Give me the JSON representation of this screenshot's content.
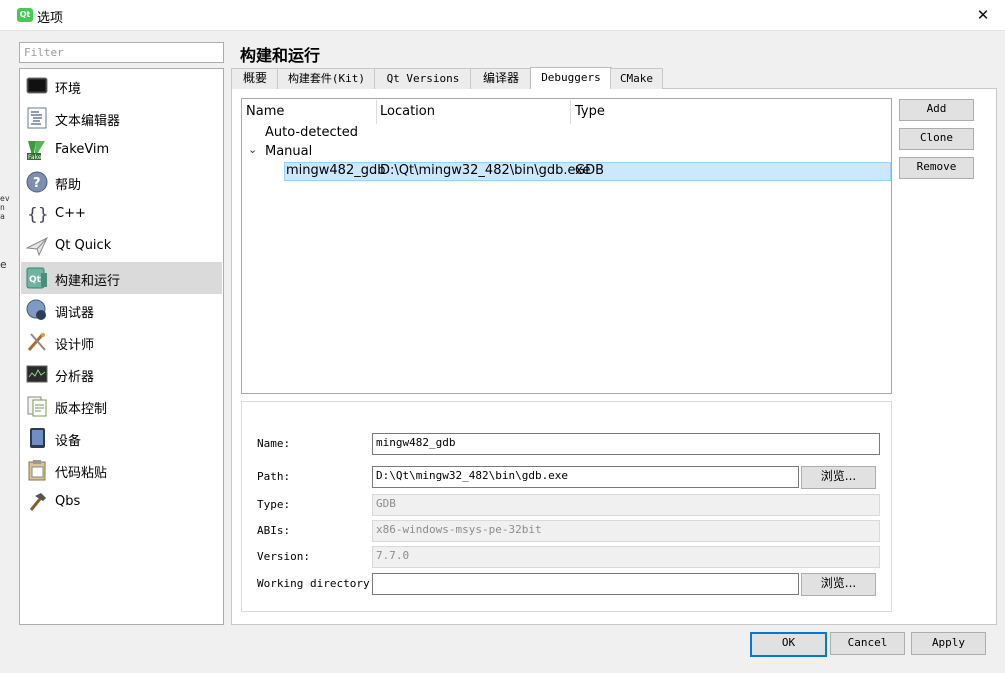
{
  "window": {
    "title": "选项",
    "app_icon": "qt-icon",
    "close": "✕"
  },
  "filter": {
    "placeholder": "Filter"
  },
  "categories": [
    {
      "label": "环境",
      "icon": "monitor-icon"
    },
    {
      "label": "文本编辑器",
      "icon": "text-editor-icon"
    },
    {
      "label": "FakeVim",
      "icon": "fakevim-icon"
    },
    {
      "label": "帮助",
      "icon": "help-icon"
    },
    {
      "label": "C++",
      "icon": "braces-icon"
    },
    {
      "label": "Qt Quick",
      "icon": "paper-plane-icon"
    },
    {
      "label": "构建和运行",
      "icon": "qt-build-icon",
      "selected": true
    },
    {
      "label": "调试器",
      "icon": "debugger-icon"
    },
    {
      "label": "设计师",
      "icon": "designer-icon"
    },
    {
      "label": "分析器",
      "icon": "analyzer-icon"
    },
    {
      "label": "版本控制",
      "icon": "version-control-icon"
    },
    {
      "label": "设备",
      "icon": "device-icon"
    },
    {
      "label": "代码粘贴",
      "icon": "code-paste-icon"
    },
    {
      "label": "Qbs",
      "icon": "hammer-icon"
    }
  ],
  "page": {
    "title": "构建和运行"
  },
  "tabs": [
    {
      "label": "概要"
    },
    {
      "label": "构建套件(Kit)"
    },
    {
      "label": "Qt Versions"
    },
    {
      "label": "编译器"
    },
    {
      "label": "Debuggers",
      "active": true
    },
    {
      "label": "CMake"
    }
  ],
  "tree": {
    "columns": [
      "Name",
      "Location",
      "Type"
    ],
    "groups": [
      {
        "label": "Auto-detected"
      },
      {
        "label": "Manual",
        "expanded": true
      }
    ],
    "rows": [
      {
        "name": "mingw482_gdb",
        "location": "D:\\Qt\\mingw32_482\\bin\\gdb.exe",
        "type": "GDB",
        "selected": true
      }
    ]
  },
  "side_buttons": {
    "add": "Add",
    "clone": "Clone",
    "remove": "Remove"
  },
  "details": {
    "name_label": "Name:",
    "name_value": "mingw482_gdb",
    "path_label": "Path:",
    "path_value": "D:\\Qt\\mingw32_482\\bin\\gdb.exe",
    "type_label": "Type:",
    "type_value": "GDB",
    "abis_label": "ABIs:",
    "abis_value": "x86-windows-msys-pe-32bit",
    "version_label": "Version:",
    "version_value": "7.7.0",
    "workdir_label": "Working directory:",
    "workdir_value": "",
    "browse_label": "浏览..."
  },
  "buttons": {
    "ok": "OK",
    "cancel": "Cancel",
    "apply": "Apply"
  }
}
